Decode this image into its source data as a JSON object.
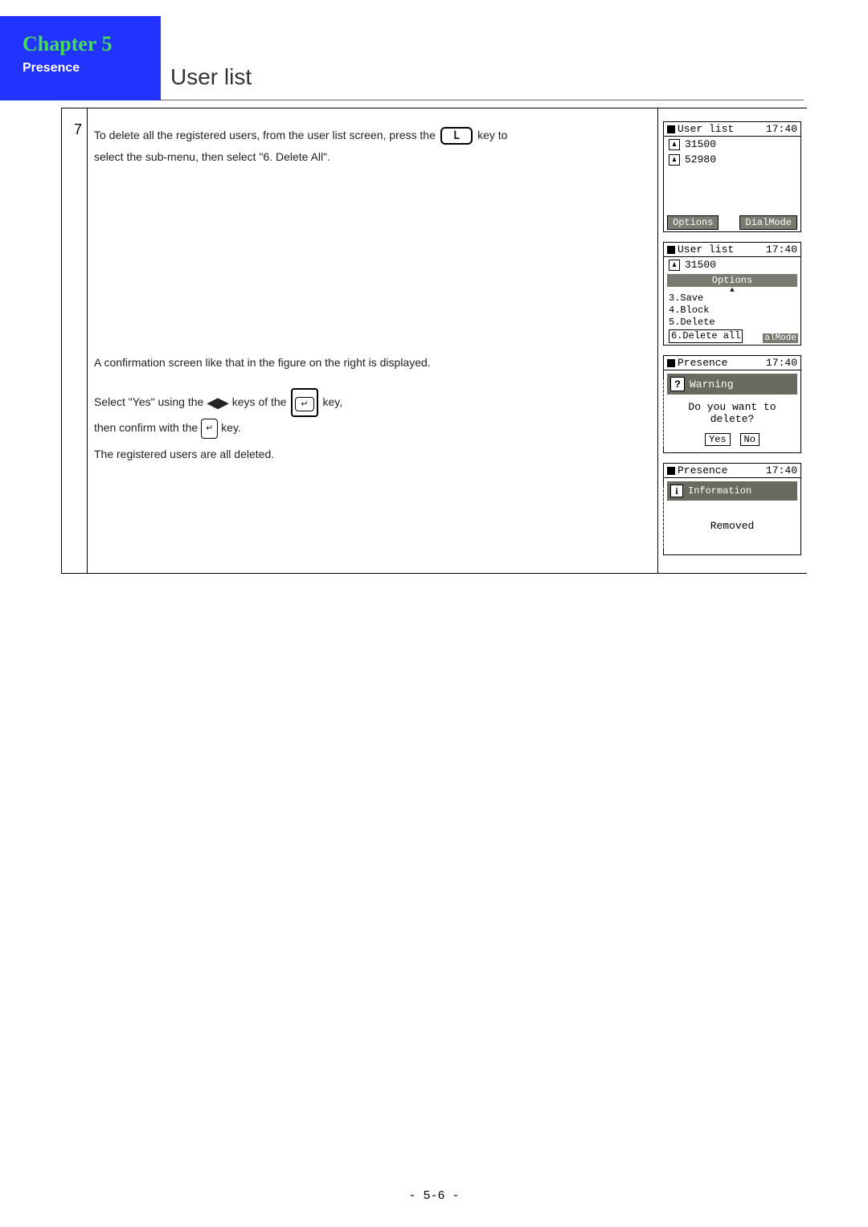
{
  "header": {
    "chapter": "Chapter 5",
    "presence": "Presence",
    "section_title": "User list"
  },
  "step": {
    "number": "7",
    "line1a": "To delete all the registered users, from the user list screen, press the ",
    "key_L": "L",
    "line1b": " key to",
    "line2": "select the sub-menu, then select \"6. Delete All\".",
    "confirm_line": "A confirmation screen like that in the figure on the right is displayed.",
    "select_a": "Select \"Yes\" using the ",
    "select_b": " keys of the ",
    "select_c": " key,",
    "confirm_a": "then confirm with the ",
    "confirm_b": " key.",
    "deleted_line": "The registered users are all deleted."
  },
  "screen1": {
    "title": "User list",
    "time": "17:40",
    "rows": [
      "31500",
      "52980"
    ],
    "opt": "Options",
    "mode": "DialMode"
  },
  "screen2": {
    "title": "User list",
    "time": "17:40",
    "row1": "31500",
    "opt_hdr": "Options",
    "items": [
      "3.Save",
      "4.Block",
      "5.Delete",
      "6.Delete all"
    ],
    "mode": "alMode"
  },
  "screen3": {
    "title": "Presence",
    "time": "17:40",
    "banner": "Warning",
    "q1": "Do you want to",
    "q2": "delete?",
    "yes": "Yes",
    "no": "No"
  },
  "screen4": {
    "title": "Presence",
    "time": "17:40",
    "banner": "Information",
    "msg": "Removed"
  },
  "footer": {
    "page": "- 5-6 -"
  }
}
